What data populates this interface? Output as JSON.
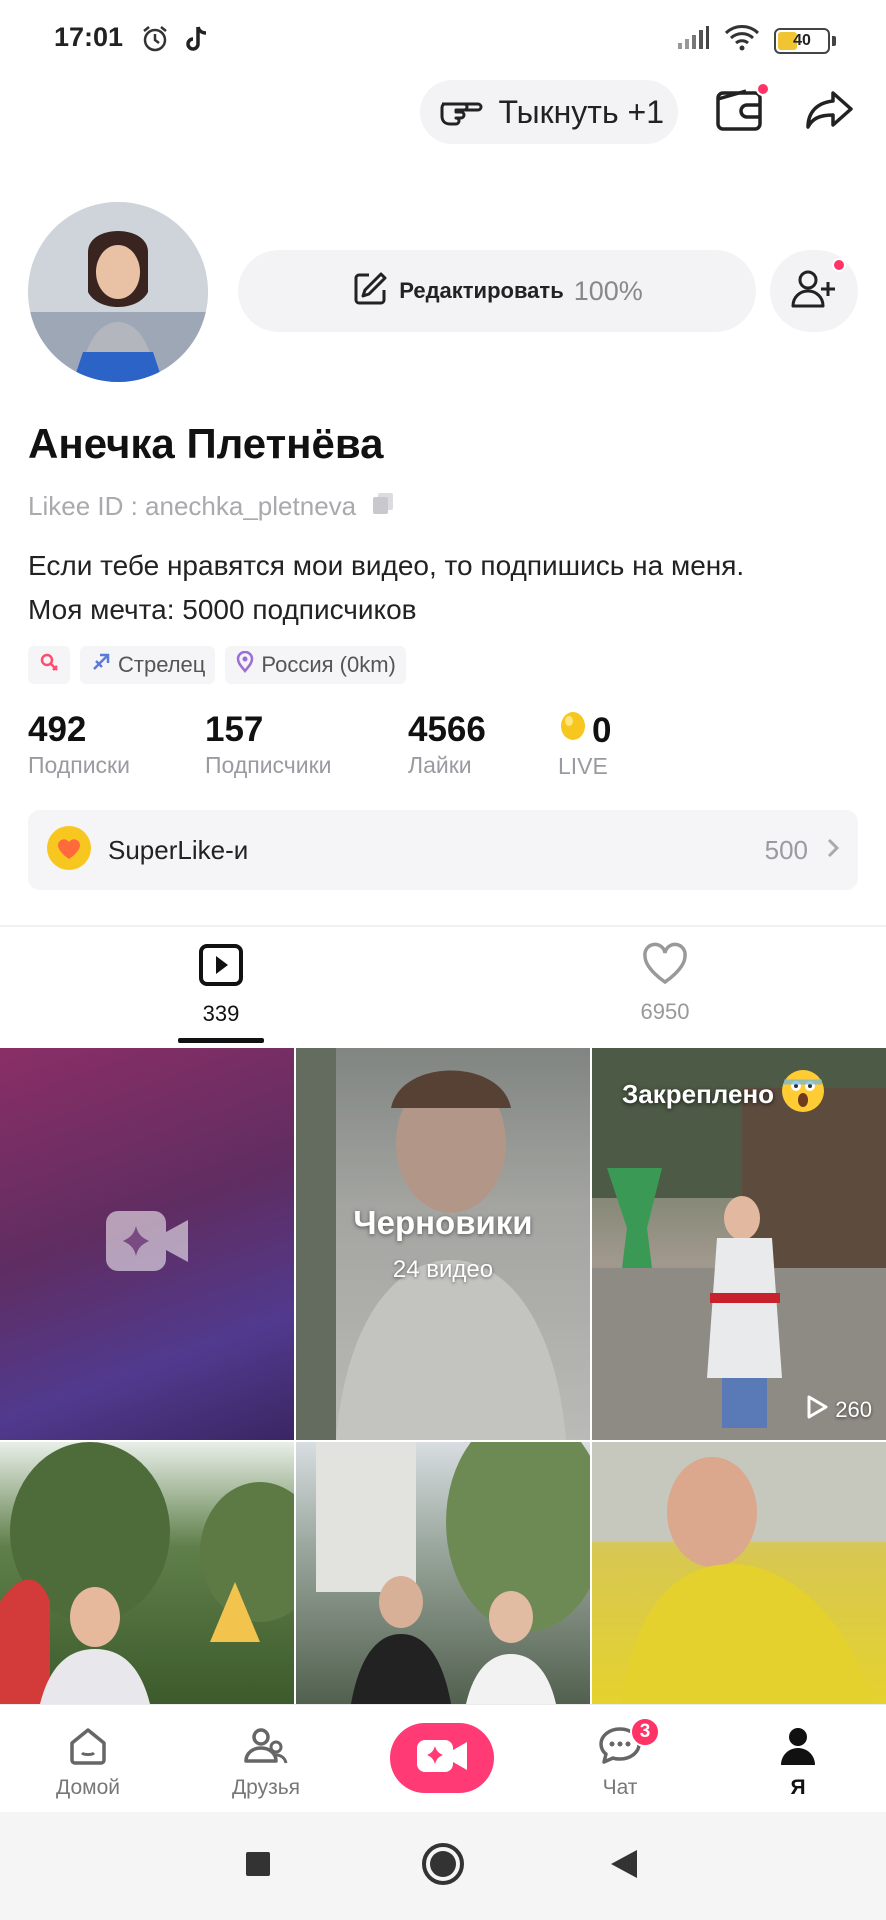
{
  "status_bar": {
    "time": "17:01",
    "battery": "40",
    "battery_level": 0.4
  },
  "top_actions": {
    "poke_label": "Тыкнуть +1",
    "icons": [
      "poke-hand-icon",
      "wallet-icon",
      "share-icon"
    ]
  },
  "profile": {
    "edit_label": "Редактировать",
    "edit_percent": "100%",
    "name": "Анечка Плетнёва",
    "likee_id": "Likee ID : anechka_pletneva",
    "bio_line1": "Если тебе нравятся мои видео, то подпишись на меня.",
    "bio_line2": "Моя мечта: 5000 подписчиков",
    "tags": {
      "zodiac": "Стрелец",
      "location": "Россия (0km)"
    }
  },
  "stats": [
    {
      "value": "492",
      "label": "Подписки"
    },
    {
      "value": "157",
      "label": "Подписчики"
    },
    {
      "value": "4566",
      "label": "Лайки"
    },
    {
      "value": "0",
      "label": "LIVE"
    }
  ],
  "superlike": {
    "label": "SuperLike-и",
    "count": "500"
  },
  "tabs": [
    {
      "count": "339",
      "icon": "video-play-icon",
      "active": true
    },
    {
      "count": "6950",
      "icon": "heart-icon",
      "active": false
    }
  ],
  "grid": {
    "drafts_title": "Черновики",
    "drafts_count": "24 видео",
    "pinned_label": "Закреплено",
    "pinned_plays": "260"
  },
  "bottom_nav": {
    "home": "Домой",
    "friends": "Друзья",
    "chat": "Чат",
    "chat_badge": "3",
    "me": "Я"
  },
  "colors": {
    "accent": "#ff3a74",
    "badge": "#ff3366"
  }
}
